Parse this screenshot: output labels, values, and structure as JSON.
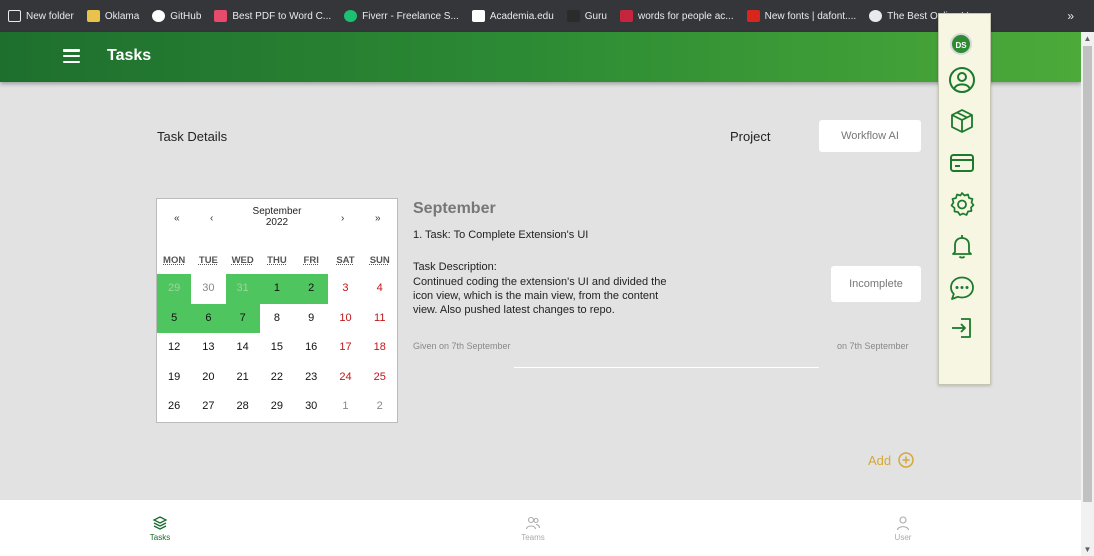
{
  "bookmarks": [
    {
      "label": "New folder",
      "icon": "bookmark-page-icon",
      "color": "#35363a"
    },
    {
      "label": "Oklama",
      "icon": "folder-icon",
      "color": "#e8c24a"
    },
    {
      "label": "GitHub",
      "icon": "github-icon",
      "color": "#ffffff"
    },
    {
      "label": "Best PDF to Word C...",
      "icon": "pdf-icon",
      "color": "#e84a6b"
    },
    {
      "label": "Fiverr - Freelance S...",
      "icon": "fiverr-icon",
      "color": "#1dbf73"
    },
    {
      "label": "Academia.edu",
      "icon": "academia-icon",
      "color": "#ffffff"
    },
    {
      "label": "Guru",
      "icon": "guru-icon",
      "color": "#2b2b2b"
    },
    {
      "label": "words for people ac...",
      "icon": "words-icon",
      "color": "#c7253e"
    },
    {
      "label": "New fonts | dafont....",
      "icon": "dafont-icon",
      "color": "#d9261c"
    },
    {
      "label": "The Best Online V",
      "icon": "cloud-icon",
      "color": "#e8eaed"
    }
  ],
  "bookmarks_more": "»",
  "header": {
    "title": "Tasks"
  },
  "top": {
    "task_details": "Task Details",
    "project": "Project",
    "workflow_button": "Workflow AI"
  },
  "calendar": {
    "prev_year": "«",
    "prev_month": "‹",
    "month": "September",
    "year": "2022",
    "next_month": "›",
    "next_year": "»",
    "weekdays": [
      "MON",
      "TUE",
      "WED",
      "THU",
      "FRI",
      "SAT",
      "SUN"
    ],
    "weeks": [
      [
        {
          "d": "29",
          "o": true,
          "h": true
        },
        {
          "d": "30",
          "o": true
        },
        {
          "d": "31",
          "o": true,
          "h": true
        },
        {
          "d": "1",
          "h": true
        },
        {
          "d": "2",
          "h": true
        },
        {
          "d": "3",
          "w": true
        },
        {
          "d": "4",
          "w": true
        }
      ],
      [
        {
          "d": "5",
          "h": true
        },
        {
          "d": "6",
          "h": true
        },
        {
          "d": "7",
          "h": true
        },
        {
          "d": "8"
        },
        {
          "d": "9"
        },
        {
          "d": "10",
          "w": true
        },
        {
          "d": "11",
          "w": true
        }
      ],
      [
        {
          "d": "12"
        },
        {
          "d": "13"
        },
        {
          "d": "14"
        },
        {
          "d": "15"
        },
        {
          "d": "16"
        },
        {
          "d": "17",
          "w": true
        },
        {
          "d": "18",
          "w": true
        }
      ],
      [
        {
          "d": "19"
        },
        {
          "d": "20"
        },
        {
          "d": "21"
        },
        {
          "d": "22"
        },
        {
          "d": "23"
        },
        {
          "d": "24",
          "w": true
        },
        {
          "d": "25",
          "w": true
        }
      ],
      [
        {
          "d": "26"
        },
        {
          "d": "27"
        },
        {
          "d": "28"
        },
        {
          "d": "29"
        },
        {
          "d": "30"
        },
        {
          "d": "1",
          "o": true
        },
        {
          "d": "2",
          "o": true
        }
      ]
    ]
  },
  "task": {
    "month_heading": "September",
    "title": "1. Task: To Complete Extension's UI",
    "description_label": "Task Description:",
    "description": "Continued coding the extension's UI and divided the icon view, which is the main view, from the content view. Also pushed latest changes to repo.",
    "given": "Given on 7th September",
    "status_button": "Incomplete",
    "on_date": "on 7th September"
  },
  "add": {
    "label": "Add"
  },
  "bottom_nav": [
    {
      "label": "Tasks",
      "icon": "layers-icon",
      "active": true
    },
    {
      "label": "Teams",
      "icon": "team-icon",
      "active": false
    },
    {
      "label": "User",
      "icon": "user-icon",
      "active": false
    }
  ],
  "extension_panel": {
    "logo_text": "DS",
    "icons": [
      "profile-icon",
      "box-icon",
      "card-icon",
      "settings-icon",
      "bell-icon",
      "chat-icon",
      "logout-icon"
    ]
  },
  "colors": {
    "header_dark": "#1e6f2e",
    "header_light": "#4caa3a",
    "calendar_highlight": "#4ec55e",
    "weekend": "#c0161b",
    "add_accent": "#d4a93a",
    "icon_green": "#1b7a2c"
  }
}
